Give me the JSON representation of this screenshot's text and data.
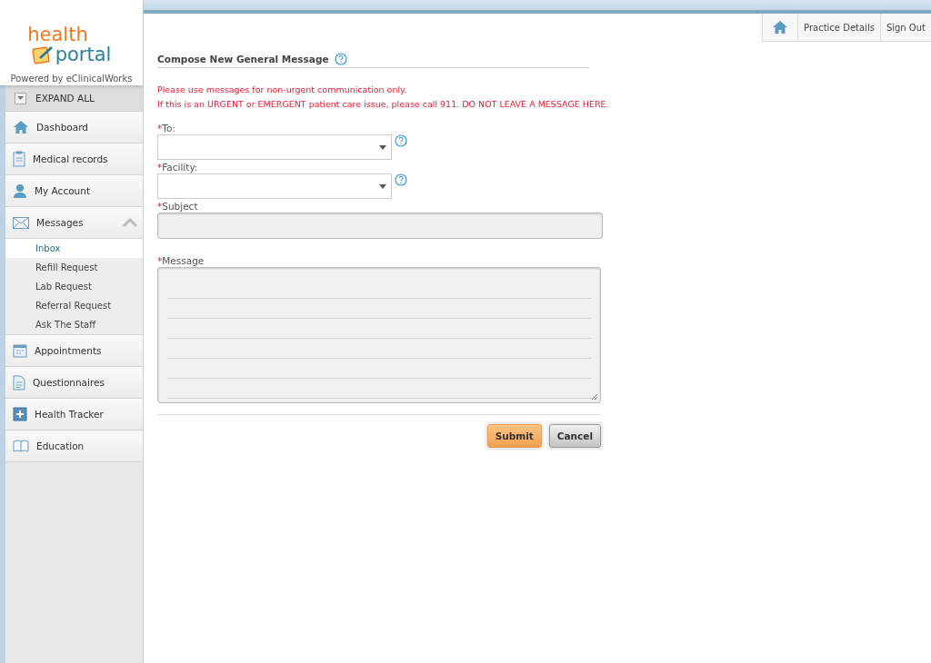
{
  "logo": {
    "line1": "health",
    "line2": "portal",
    "tagline": "Powered by eClinicalWorks"
  },
  "expand_all": "EXPAND ALL",
  "nav": [
    {
      "label": "Dashboard",
      "expanded": false
    },
    {
      "label": "Medical records",
      "expanded": false
    },
    {
      "label": "My Account",
      "expanded": false
    },
    {
      "label": "Messages",
      "expanded": true,
      "children": [
        {
          "label": "Inbox",
          "selected": true
        },
        {
          "label": "Refill Request",
          "selected": false
        },
        {
          "label": "Lab Request",
          "selected": false
        },
        {
          "label": "Referral Request",
          "selected": false
        },
        {
          "label": "Ask The Staff",
          "selected": false
        }
      ]
    },
    {
      "label": "Appointments",
      "expanded": false
    },
    {
      "label": "Questionnaires",
      "expanded": false
    },
    {
      "label": "Health Tracker",
      "expanded": false
    },
    {
      "label": "Education",
      "expanded": false
    }
  ],
  "top_links": [
    "Practice Details",
    "Sign Out"
  ],
  "form": {
    "title": "Compose New General Message",
    "notices": [
      "Please use messages for non-urgent communication only.",
      "If this is an URGENT or EMERGENT patient care issue, please call 911. DO NOT LEAVE A MESSAGE HERE."
    ],
    "fields": [
      {
        "kind": "select",
        "required_mark": "*",
        "label": "To:",
        "help": true
      },
      {
        "kind": "select",
        "required_mark": "*",
        "label": "Facility:",
        "help": true
      },
      {
        "kind": "text",
        "required_mark": "*",
        "label": "Subject"
      },
      {
        "kind": "textarea",
        "required_mark": "*",
        "label": "Message"
      }
    ],
    "buttons": [
      {
        "kind": "primary",
        "label": "Submit"
      },
      {
        "kind": "secondary",
        "label": "Cancel"
      }
    ]
  }
}
